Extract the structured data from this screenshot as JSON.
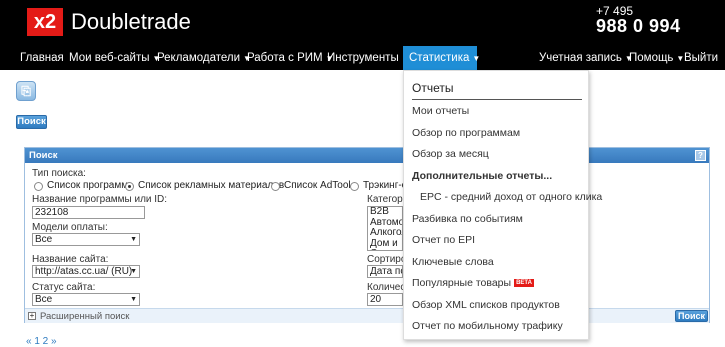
{
  "brand": {
    "logo_mark": "x2",
    "name": "Doubletrade",
    "accent": "#e41b17"
  },
  "phone": {
    "prefix": "+7 495",
    "number": "988 0 994"
  },
  "nav": {
    "items": [
      {
        "label": "Главная",
        "caret": ""
      },
      {
        "label": "Мои веб-сайты",
        "caret": "▼"
      },
      {
        "label": "Рекламодатели",
        "caret": "▼"
      },
      {
        "label": "Работа с РИМ",
        "caret": "▼"
      },
      {
        "label": "Инструменты",
        "caret": "▼"
      },
      {
        "label": "Статистика",
        "caret": "▼"
      },
      {
        "label": "Учетная запись",
        "caret": "▼"
      },
      {
        "label": "Помощь",
        "caret": "▼"
      },
      {
        "label": "Выйти",
        "caret": ""
      }
    ],
    "active_color": "#1f8ed6"
  },
  "toolbar": {
    "search_button": "Поиск"
  },
  "search_panel": {
    "title": "Поиск",
    "help": "?",
    "search_type_label": "Тип поиска:",
    "search_types": [
      {
        "label": "Список программ",
        "selected": false
      },
      {
        "label": "Список рекламных материалов",
        "selected": true
      },
      {
        "label": "Список AdTool",
        "selected": false
      },
      {
        "label": "Трэкинг-с",
        "selected": false
      }
    ],
    "program_label": "Название программы или ID:",
    "program_value": "232108",
    "payment_label": "Модели оплаты:",
    "payment_value": "Все",
    "site_label": "Название сайта:",
    "site_value": "http://atas.cc.ua/ (RU)",
    "status_label": "Статус сайта:",
    "status_value": "Все",
    "category_label": "Категори",
    "categories": [
      "B2B",
      "Автомоб",
      "Алкоголі",
      "Дом и С"
    ],
    "sort_label": "Сортирово",
    "sort_value": "Дата по",
    "count_label": "Количест",
    "count_value": "20",
    "advanced_label": "Расширенный поиск",
    "submit_label": "Поиск"
  },
  "pager": {
    "text": "« 1 2 »"
  },
  "dropdown": {
    "heading": "Отчеты",
    "items": [
      {
        "label": "Мои отчеты",
        "bold": false,
        "indent": false,
        "badge": ""
      },
      {
        "label": "Обзор по программам",
        "bold": false,
        "indent": false,
        "badge": ""
      },
      {
        "label": "Обзор за месяц",
        "bold": false,
        "indent": false,
        "badge": ""
      },
      {
        "label": "Дополнительные отчеты...",
        "bold": true,
        "indent": false,
        "badge": ""
      },
      {
        "label": "EPC - средний доход от одного клика",
        "bold": false,
        "indent": true,
        "badge": ""
      },
      {
        "label": "Разбивка по событиям",
        "bold": false,
        "indent": false,
        "badge": ""
      },
      {
        "label": "Отчет по EPI",
        "bold": false,
        "indent": false,
        "badge": ""
      },
      {
        "label": "Ключевые слова",
        "bold": false,
        "indent": false,
        "badge": ""
      },
      {
        "label": "Популярные товары",
        "bold": false,
        "indent": false,
        "badge": "BETA"
      },
      {
        "label": "Обзор XML списков продуктов",
        "bold": false,
        "indent": false,
        "badge": ""
      },
      {
        "label": "Отчет по мобильному трафику",
        "bold": false,
        "indent": false,
        "badge": ""
      }
    ]
  }
}
